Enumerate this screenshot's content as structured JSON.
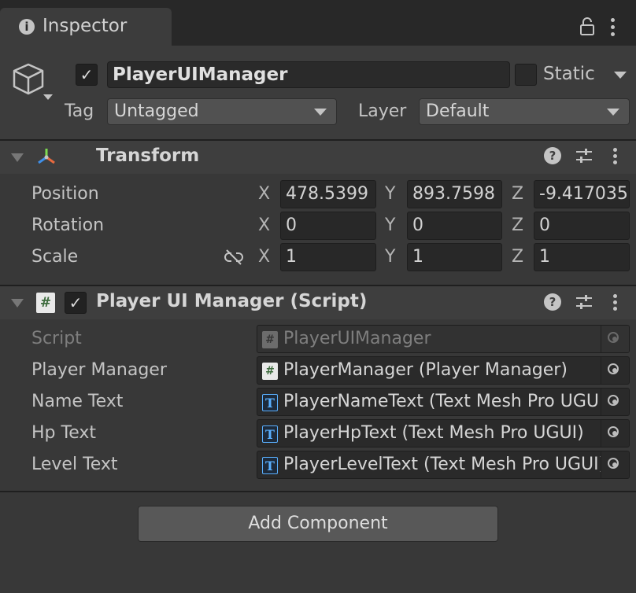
{
  "tab": {
    "title": "Inspector",
    "info_icon": "info-icon",
    "lock_icon": "lock-icon",
    "menu_icon": "kebab-menu-icon"
  },
  "gameobject": {
    "active": true,
    "name": "PlayerUIManager",
    "static_label": "Static",
    "static_checked": false,
    "tag_label": "Tag",
    "tag_value": "Untagged",
    "layer_label": "Layer",
    "layer_value": "Default"
  },
  "transform": {
    "title": "Transform",
    "rows": [
      {
        "label": "Position",
        "x": "478.5399",
        "y": "893.7598",
        "z": "-9.417035"
      },
      {
        "label": "Rotation",
        "x": "0",
        "y": "0",
        "z": "0"
      },
      {
        "label": "Scale",
        "x": "1",
        "y": "1",
        "z": "1"
      }
    ],
    "axis": {
      "x": "X",
      "y": "Y",
      "z": "Z"
    }
  },
  "script_component": {
    "title": "Player UI Manager (Script)",
    "enabled": true,
    "fields": [
      {
        "label": "Script",
        "value": "PlayerUIManager",
        "icon": "script-icon",
        "disabled": true
      },
      {
        "label": "Player Manager",
        "value": "PlayerManager (Player Manager)",
        "icon": "script-icon",
        "disabled": false
      },
      {
        "label": "Name Text",
        "value": "PlayerNameText (Text Mesh Pro UGUI)",
        "icon": "textmeshpro-icon",
        "disabled": false
      },
      {
        "label": "Hp Text",
        "value": "PlayerHpText (Text Mesh Pro UGUI)",
        "icon": "textmeshpro-icon",
        "disabled": false
      },
      {
        "label": "Level Text",
        "value": "PlayerLevelText (Text Mesh Pro UGUI)",
        "icon": "textmeshpro-icon",
        "disabled": false
      }
    ]
  },
  "add_component_label": "Add Component",
  "icon_glyphs": {
    "check": "✓",
    "script": "#",
    "tmp": "T",
    "help": "?",
    "info": "i"
  }
}
